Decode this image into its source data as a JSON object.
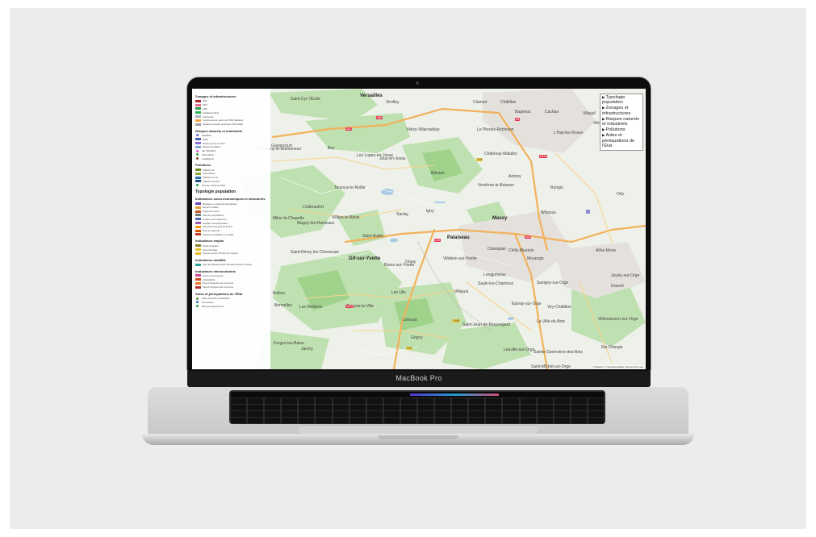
{
  "device": {
    "label": "MacBook Pro"
  },
  "legend": {
    "sections": [
      {
        "title": "Zonages et infrastructures",
        "items": [
          {
            "label": "ZAE",
            "color": "#b3262b",
            "kind": "swatch"
          },
          {
            "label": "QPV",
            "color": "#e86d92",
            "kind": "swatch"
          },
          {
            "label": "ZRR",
            "color": "#2f9e44",
            "kind": "swatch"
          },
          {
            "label": "Si bâtiment fibré",
            "color": "#2bb24c",
            "kind": "swatch"
          },
          {
            "label": "Autoroutes",
            "color": "#aab0c0",
            "kind": "swatch"
          },
          {
            "label": "Communes de moins de 5 000 habitants",
            "color": "#f1a340",
            "kind": "swatch"
          },
          {
            "label": "Variation annuelle population 2014-2020",
            "color": "#9aa0a6",
            "kind": "swatch"
          }
        ]
      },
      {
        "title": "Risques naturels et industriels",
        "items": [
          {
            "label": "SEVESO",
            "color": "#5b6dc9",
            "kind": "dot"
          },
          {
            "label": "PPRI",
            "color": "#3f62b7",
            "kind": "swatch"
          },
          {
            "label": "Risque de feu de forêt",
            "color": "#8a6bd6",
            "kind": "swatch"
          },
          {
            "label": "Risque inondation",
            "color": "#7ea9d8",
            "kind": "swatch"
          },
          {
            "label": "Site SEVESO",
            "color": "#d15bd3",
            "kind": "dot"
          },
          {
            "label": "Sols pollués",
            "color": "#2f9e44",
            "kind": "dot"
          },
          {
            "label": "Installations",
            "color": "#7a4b2a",
            "kind": "dot"
          }
        ]
      },
      {
        "title": "Pollutions",
        "items": [
          {
            "label": "Pollution air",
            "color": "#6b8e23",
            "kind": "swatch"
          },
          {
            "label": "Sols pollués",
            "color": "#8aa637",
            "kind": "swatch"
          },
          {
            "label": "Pollution du sol",
            "color": "#2c6fb7",
            "kind": "swatch"
          },
          {
            "label": "Pollution réseaux",
            "color": "#1e4e8c",
            "kind": "swatch"
          },
          {
            "label": "Nombre d'actions 2024",
            "color": "#2f9e44",
            "kind": "dot"
          }
        ]
      },
      {
        "title": "Typologie population",
        "big": true,
        "items": []
      },
      {
        "title": "Indicateurs socio-économiques et structurels",
        "items": [
          {
            "label": "Ménages en précarité énergétique",
            "color": "#6a3fb5",
            "kind": "swatch"
          },
          {
            "label": "Revenu médian",
            "color": "#e0a030",
            "kind": "swatch"
          },
          {
            "label": "Logement social",
            "color": "#c0582b",
            "kind": "swatch"
          },
          {
            "label": "Taux de propriétaires",
            "color": "#7a7a7a",
            "kind": "swatch"
          },
          {
            "label": "Tension sur le logement",
            "color": "#4b6cb7",
            "kind": "swatch"
          },
          {
            "label": "Familles monoparentales",
            "color": "#9b59b6",
            "kind": "swatch"
          },
          {
            "label": "Proportion des plus de 65 ans",
            "color": "#f39c12",
            "kind": "swatch"
          },
          {
            "label": "Taux de pauvreté",
            "color": "#d35400",
            "kind": "swatch"
          },
          {
            "label": "Pression immobilière et sociale",
            "color": "#c0392b",
            "kind": "swatch"
          }
        ]
      },
      {
        "title": "Indicateurs emploi",
        "items": [
          {
            "label": "Emploi précaire",
            "color": "#8e7d2a",
            "kind": "swatch"
          },
          {
            "label": "Taux chômage",
            "color": "#e6c229",
            "kind": "swatch"
          },
          {
            "label": "Taux de jeunes (16-25) non insérés",
            "color": "#f0b429",
            "kind": "swatch"
          }
        ]
      },
      {
        "title": "Indicateurs mobilité",
        "items": [
          {
            "label": "Part des déplacements domicile-travail en voiture",
            "color": "#2aa198",
            "kind": "swatch"
          }
        ]
      },
      {
        "title": "Indicateurs intersectoriels",
        "items": [
          {
            "label": "Zones cumul risques",
            "color": "#d34a8c",
            "kind": "swatch"
          },
          {
            "label": "Vulnérabilité",
            "color": "#c94c1f",
            "kind": "swatch"
          },
          {
            "label": "Taux d'étrangers par commune",
            "color": "#e57a23",
            "kind": "swatch"
          },
          {
            "label": "Taux d'immigrés par commune",
            "color": "#b7312f",
            "kind": "swatch"
          }
        ]
      },
      {
        "title": "Aides et péréquations de l'État",
        "items": [
          {
            "label": "Aides financières DSR/DSU",
            "color": "#5a8f3e",
            "kind": "dot"
          },
          {
            "label": "Nos actions",
            "color": "#3b6fb6",
            "kind": "dot"
          },
          {
            "label": "DPV par département",
            "color": "#2f9e44",
            "kind": "dot"
          }
        ]
      }
    ]
  },
  "layers_panel": {
    "items": [
      {
        "label": "Typologie population"
      },
      {
        "label": "Zonages et infrastructures"
      },
      {
        "label": "Risques naturels et industriels"
      },
      {
        "label": "Pollutions"
      },
      {
        "label": "Aides et péréquations de l'État"
      }
    ]
  },
  "map": {
    "attribution": "© Mapbox © OpenStreetMap Improve this map",
    "places": [
      {
        "name": "Versailles",
        "major": true
      },
      {
        "name": "Saint-Cyr-l'École"
      },
      {
        "name": "Viroflay"
      },
      {
        "name": "Clamart"
      },
      {
        "name": "Châtillon"
      },
      {
        "name": "Bagneux"
      },
      {
        "name": "Cachan"
      },
      {
        "name": "Villejuif"
      },
      {
        "name": "Vitry"
      },
      {
        "name": "Vélizy-Villacoublay"
      },
      {
        "name": "Le Plessis-Robinson"
      },
      {
        "name": "L'Haÿ-les-Roses"
      },
      {
        "name": "Guyancourt"
      },
      {
        "name": "Buc"
      },
      {
        "name": "Montigny-le-Bretonneux"
      },
      {
        "name": "Les Loges-en-Josas"
      },
      {
        "name": "Jouy-en-Josas"
      },
      {
        "name": "Châtenay-Malabry"
      },
      {
        "name": "Bièvres"
      },
      {
        "name": "Antony"
      },
      {
        "name": "Toussus-le-Noble"
      },
      {
        "name": "Verrières-le-Buisson"
      },
      {
        "name": "Rungis"
      },
      {
        "name": "Orly"
      },
      {
        "name": "Châteaufort"
      },
      {
        "name": "Saclay"
      },
      {
        "name": "Igny"
      },
      {
        "name": "Massy",
        "major": true
      },
      {
        "name": "Wissous"
      },
      {
        "name": "Milon-la-Chapelle"
      },
      {
        "name": "Magny-les-Hameaux"
      },
      {
        "name": "Villiers-le-Bâcle"
      },
      {
        "name": "Saint-Aubin"
      },
      {
        "name": "Palaiseau",
        "major": true
      },
      {
        "name": "Champlan"
      },
      {
        "name": "Chilly-Mazarin"
      },
      {
        "name": "Athis-Mons"
      },
      {
        "name": "Saint-Rémy-lès-Chevreuse"
      },
      {
        "name": "Gif-sur-Yvette",
        "major": true
      },
      {
        "name": "Bures-sur-Yvette"
      },
      {
        "name": "Orsay"
      },
      {
        "name": "Villebon-sur-Yvette"
      },
      {
        "name": "Morangis"
      },
      {
        "name": "Juvisy-sur-Orge"
      },
      {
        "name": "Longjumeau"
      },
      {
        "name": "Savigny-sur-Orge"
      },
      {
        "name": "Draveil"
      },
      {
        "name": "Bullion"
      },
      {
        "name": "Saulx-les-Chartreux"
      },
      {
        "name": "Villejust"
      },
      {
        "name": "Les Ulis"
      },
      {
        "name": "Épinay-sur-Orge"
      },
      {
        "name": "Viry-Châtillon"
      },
      {
        "name": "Bonnelles"
      },
      {
        "name": "Les Molières"
      },
      {
        "name": "Gometz-la-Ville"
      },
      {
        "name": "Limours"
      },
      {
        "name": "Saint-Jean-de-Beauregard"
      },
      {
        "name": "La Ville-du-Bois"
      },
      {
        "name": "Villemoisson-sur-Orge"
      },
      {
        "name": "Grigny"
      },
      {
        "name": "Forges-les-Bains"
      },
      {
        "name": "Janvry"
      },
      {
        "name": "Leuville-sur-Orge"
      },
      {
        "name": "Sainte-Geneviève-des-Bois"
      },
      {
        "name": "Ris-Orangis"
      },
      {
        "name": "Saint-Michel-sur-Orge"
      }
    ],
    "road_badges": [
      {
        "label": "N12",
        "type": "red"
      },
      {
        "label": "A86",
        "type": "red"
      },
      {
        "label": "A6",
        "type": "red"
      },
      {
        "label": "D36",
        "type": "yellow"
      },
      {
        "label": "N118",
        "type": "red"
      },
      {
        "label": "A10",
        "type": "red"
      },
      {
        "label": "N20",
        "type": "red"
      },
      {
        "label": "D988",
        "type": "yellow"
      },
      {
        "label": "N104",
        "type": "red"
      },
      {
        "label": "D35",
        "type": "yellow"
      }
    ]
  }
}
